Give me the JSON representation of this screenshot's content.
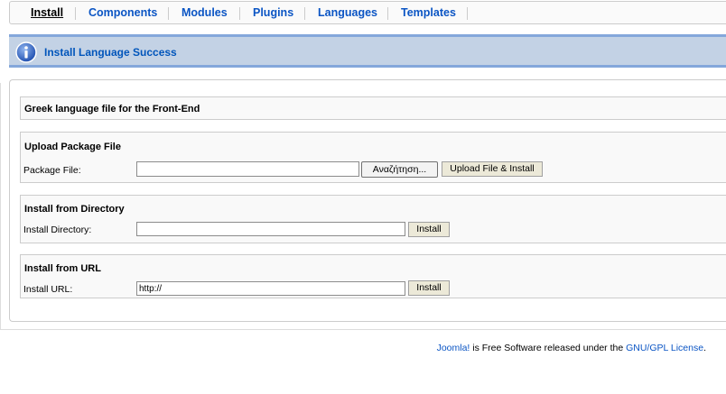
{
  "tabs": [
    {
      "label": "Install",
      "active": true
    },
    {
      "label": "Components"
    },
    {
      "label": "Modules"
    },
    {
      "label": "Plugins"
    },
    {
      "label": "Languages"
    },
    {
      "label": "Templates"
    }
  ],
  "message": {
    "text": "Install Language Success",
    "icon": "info-icon"
  },
  "result": {
    "title": "Greek language file for the Front-End"
  },
  "upload": {
    "title": "Upload Package File",
    "label": "Package File:",
    "value": "",
    "browse_label": "Αναζήτηση...",
    "submit_label": "Upload File & Install"
  },
  "directory": {
    "title": "Install from Directory",
    "label": "Install Directory:",
    "value": "",
    "submit_label": "Install"
  },
  "url": {
    "title": "Install from URL",
    "label": "Install URL:",
    "value": "http://",
    "submit_label": "Install"
  },
  "footer": {
    "joomla_link": "Joomla!",
    "text_middle": " is Free Software released under the ",
    "license_link": "GNU/GPL License",
    "text_end": "."
  },
  "colors": {
    "link": "#0B55C4",
    "message_bg": "#C3D2E5",
    "message_border": "#84A7DB",
    "message_text": "#0055BB"
  }
}
